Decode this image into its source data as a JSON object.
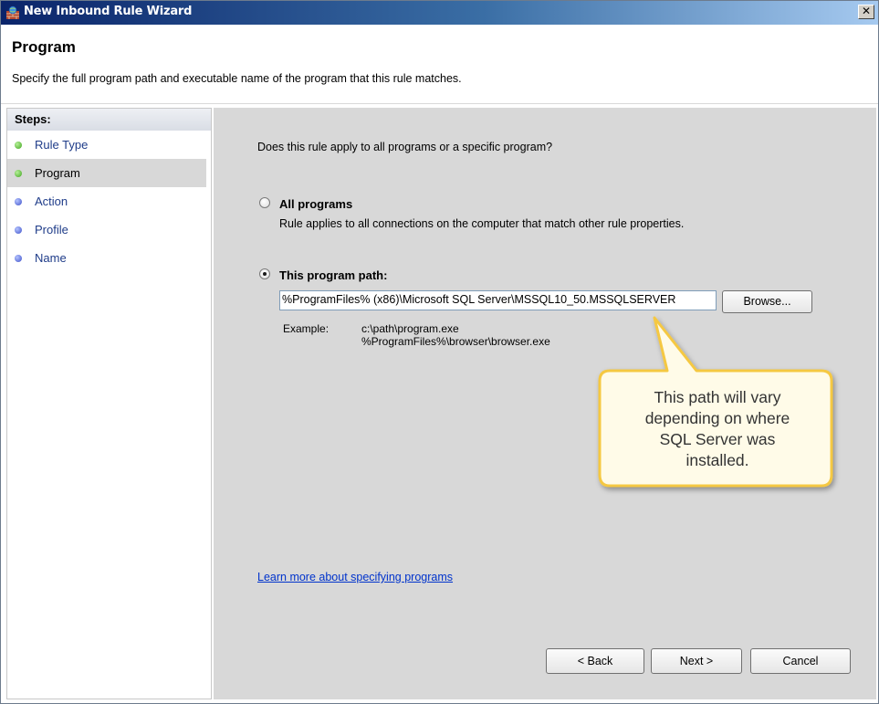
{
  "window": {
    "title": "New Inbound Rule Wizard",
    "close_label": "✕"
  },
  "header": {
    "title": "Program",
    "description": "Specify the full program path and executable name of the program that this rule matches."
  },
  "steps": {
    "heading": "Steps:",
    "items": [
      {
        "label": "Rule Type",
        "status_color": "#3fa51d"
      },
      {
        "label": "Program",
        "status_color": "#3fa51d"
      },
      {
        "label": "Action",
        "status_color": "#3d51c9"
      },
      {
        "label": "Profile",
        "status_color": "#3d51c9"
      },
      {
        "label": "Name",
        "status_color": "#3d51c9"
      }
    ],
    "active_index": 1
  },
  "main": {
    "question": "Does this rule apply to all programs or a specific program?",
    "all_programs": {
      "label": "All programs",
      "description": "Rule applies to all connections on the computer that match other rule properties.",
      "selected": false
    },
    "this_program": {
      "label": "This program path:",
      "selected": true,
      "path_value": "%ProgramFiles% (x86)\\Microsoft SQL Server\\MSSQL10_50.MSSQLSERVER",
      "browse_label": "Browse...",
      "example_label": "Example:",
      "example_line1": "c:\\path\\program.exe",
      "example_line2": "%ProgramFiles%\\browser\\browser.exe"
    },
    "learn_more": "Learn more about specifying programs"
  },
  "buttons": {
    "back": "< Back",
    "next": "Next >",
    "cancel": "Cancel"
  },
  "callout": {
    "line1": "This path will vary",
    "line2": "depending on where",
    "line3": "SQL Server was",
    "line4": "installed.",
    "fill_color": "#fffbe8",
    "border_color": "#f5c842"
  }
}
